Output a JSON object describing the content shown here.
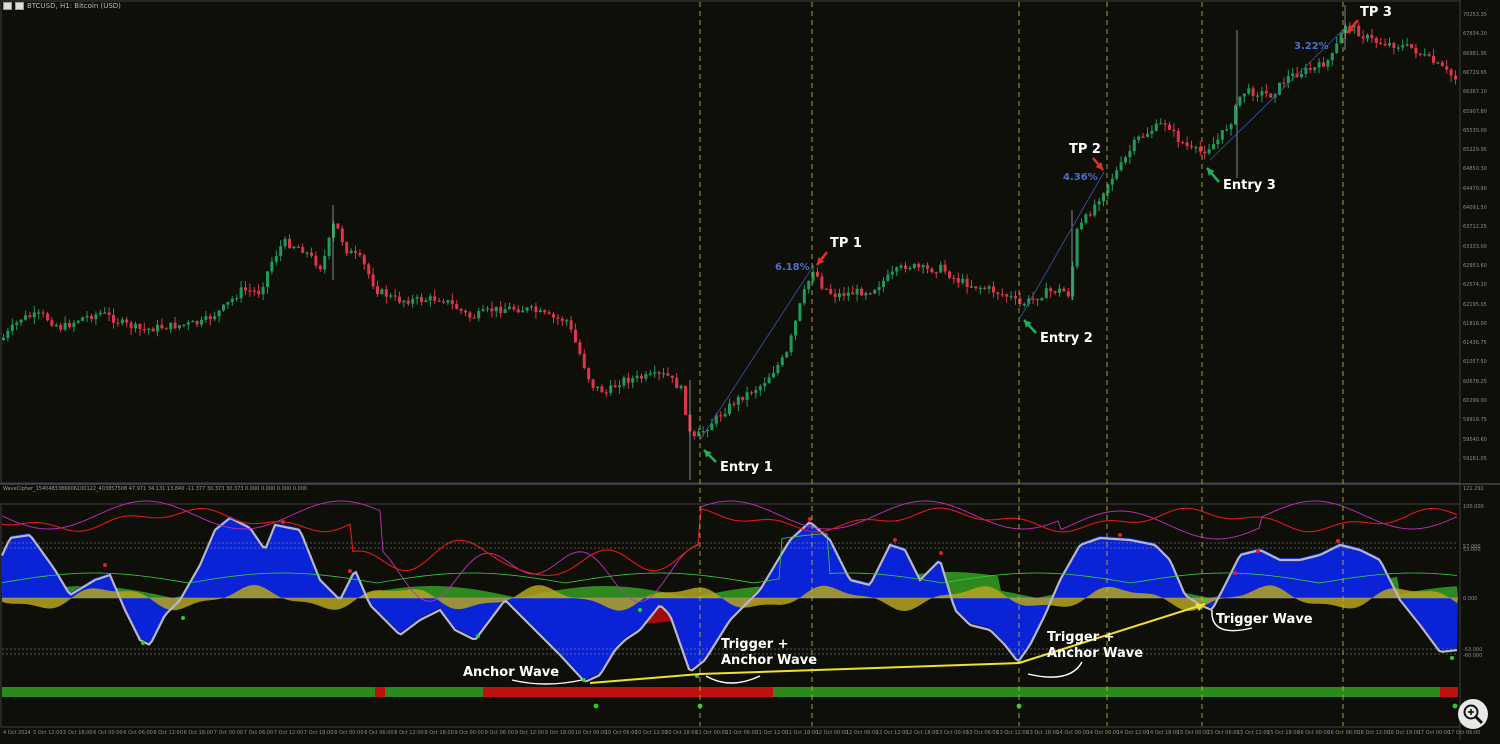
{
  "window": {
    "title": "BTCUSD, H1:  Bitcoin (USD)"
  },
  "indicator": {
    "header": "WaveCipher_1540483386606100122_403857508 47.971 34.131 13.840 -11.377 30.373 30.373 0.000 0.000 0.000 0.000"
  },
  "annotations": {
    "entry1": "Entry 1",
    "entry2": "Entry 2",
    "entry3": "Entry 3",
    "tp1": "TP 1",
    "tp2": "TP 2",
    "tp3": "TP 3",
    "pct1": "6.18%",
    "pct2": "4.36%",
    "pct3": "3.22%",
    "anchor": "Anchor Wave",
    "trigger1_line1": "Trigger +",
    "trigger1_line2": "Anchor Wave",
    "trigger2_line1": "Trigger +",
    "trigger2_line2": "Anchor Wave",
    "trigger_wave": "Trigger Wave"
  },
  "y_axis": [
    "70253.35",
    "67834.20",
    "66981.95",
    "66729.65",
    "66367.10",
    "65907.80",
    "65530.00",
    "65229.95",
    "64850.30",
    "64470.90",
    "64091.50",
    "63712.25",
    "63333.00",
    "62953.60",
    "62574.20",
    "62195.05",
    "61816.00",
    "61436.75",
    "61057.50",
    "60678.25",
    "60299.00",
    "59919.75",
    "59540.60",
    "59161.05"
  ],
  "ind_y_axis": [
    "121.292",
    "100.000",
    "57.000",
    "53.000",
    "0.000",
    "-53.000",
    "-60.000"
  ],
  "x_axis": [
    "4 Oct 2024",
    "5 Oct 12:00",
    "5 Oct 18:00",
    "6 Oct 00:00",
    "6 Oct 06:00",
    "6 Oct 12:00",
    "6 Oct 18:00",
    "7 Oct 00:00",
    "7 Oct 06:00",
    "7 Oct 12:00",
    "7 Oct 18:00",
    "8 Oct 00:00",
    "8 Oct 06:00",
    "8 Oct 12:00",
    "8 Oct 18:00",
    "9 Oct 00:00",
    "9 Oct 06:00",
    "9 Oct 12:00",
    "9 Oct 18:00",
    "10 Oct 00:00",
    "10 Oct 06:00",
    "10 Oct 12:00",
    "10 Oct 18:00",
    "11 Oct 00:00",
    "11 Oct 06:00",
    "11 Oct 12:00",
    "11 Oct 18:00",
    "12 Oct 00:00",
    "12 Oct 06:00",
    "12 Oct 12:00",
    "12 Oct 18:00",
    "13 Oct 00:00",
    "13 Oct 06:00",
    "13 Oct 12:00",
    "13 Oct 18:00",
    "14 Oct 00:00",
    "14 Oct 06:00",
    "14 Oct 12:00",
    "14 Oct 18:00",
    "15 Oct 00:00",
    "15 Oct 06:00",
    "15 Oct 12:00",
    "15 Oct 18:00",
    "16 Oct 00:00",
    "16 Oct 06:00",
    "16 Oct 12:00",
    "16 Oct 18:00",
    "17 Oct 00:00",
    "17 Oct 06:00"
  ],
  "colors": {
    "bull": "#1f9a5a",
    "bear": "#e0344a",
    "wave_blue": "#0a23d6",
    "green_area": "#2e8a1e",
    "yellow_area": "#b5a520",
    "red_area": "#a00a0a",
    "arrow_green": "#1fb05a",
    "arrow_red": "#e03030",
    "yellow_line": "#f0e030"
  },
  "icons": {
    "zoom": "zoom-magnifier-icon"
  }
}
